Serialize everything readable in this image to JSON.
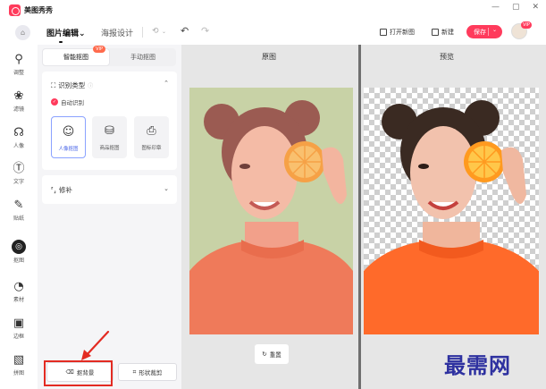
{
  "app": {
    "name": "美图秀秀"
  },
  "window": {
    "minimize": "—",
    "maximize": "▢",
    "close": "✕"
  },
  "toolbar": {
    "tab_edit": "图片编辑",
    "tab_edit_chevron": "⌄",
    "tab_poster": "海报设计",
    "open_image": "打开新图",
    "new": "新建",
    "save": "保存",
    "vip": "VIP"
  },
  "rail": [
    {
      "label": "调整",
      "icon": "sliders-icon",
      "glyph": "⚲"
    },
    {
      "label": "滤镜",
      "icon": "filter-icon",
      "glyph": "❀"
    },
    {
      "label": "人像",
      "icon": "portrait-icon",
      "glyph": "☊"
    },
    {
      "label": "文字",
      "icon": "text-icon",
      "glyph": "Ⓣ"
    },
    {
      "label": "贴纸",
      "icon": "brush-icon",
      "glyph": "✎"
    },
    {
      "label": "抠图",
      "icon": "cutout-icon",
      "glyph": "◎"
    },
    {
      "label": "素材",
      "icon": "material-icon",
      "glyph": "◔"
    },
    {
      "label": "边框",
      "icon": "frame-icon",
      "glyph": "▣"
    },
    {
      "label": "拼图",
      "icon": "collage-icon",
      "glyph": "▧"
    }
  ],
  "panel": {
    "tab_smart": "智能抠图",
    "tab_manual": "手动抠图",
    "tab_smart_badge": "VIP",
    "recognize_title": "识别类型",
    "auto_recognize": "自动识别",
    "options": [
      {
        "label": "人像抠图",
        "icon": "person-icon",
        "glyph": "☺",
        "selected": true
      },
      {
        "label": "商品抠图",
        "icon": "product-icon",
        "glyph": "⛁",
        "selected": false
      },
      {
        "label": "图标印章",
        "icon": "stamp-icon",
        "glyph": "⎙",
        "selected": false
      }
    ],
    "refine_title": "修补",
    "cutout_button": "抠背景",
    "shape_button": "形状裁剪"
  },
  "canvas": {
    "original_title": "原图",
    "preview_title": "预览",
    "reset_button": "重置"
  },
  "watermark": "最需网",
  "colors": {
    "accent": "#ff3b5c",
    "selected_border": "#8aa2ff",
    "highlight_red": "#e32b22",
    "watermark_blue": "#2e31a0",
    "original_bg_green": "#b9dca8",
    "sweater_orange": "#ff6a2a"
  }
}
